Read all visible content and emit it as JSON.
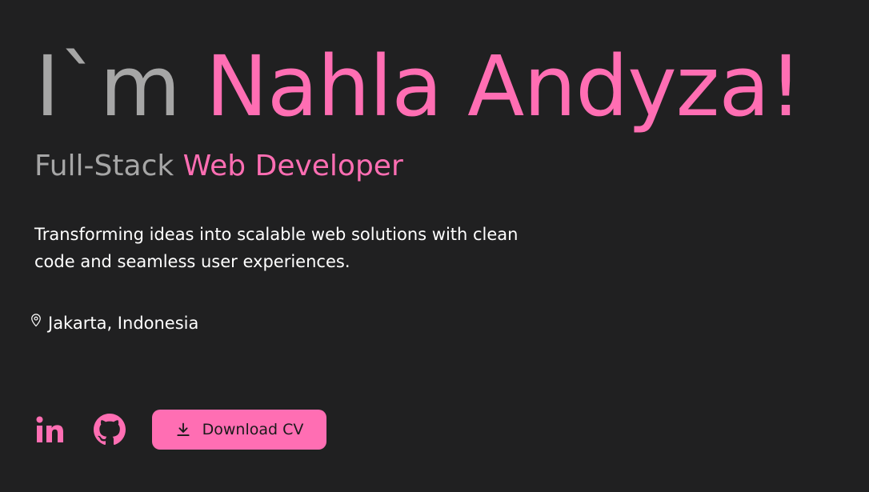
{
  "hero": {
    "greeting": "I`m",
    "name": "Nahla Andyza!",
    "role_prefix": "Full-Stack",
    "role_accent": "Web Developer",
    "tagline": "Transforming ideas into scalable web solutions with clean code and seamless user experiences.",
    "location": "Jakarta, Indonesia"
  },
  "social": [
    {
      "icon": "linkedin-icon"
    },
    {
      "icon": "github-icon"
    }
  ],
  "actions": {
    "download_cv_label": "Download CV"
  },
  "colors": {
    "background": "#202021",
    "accent": "#ff6eb3",
    "muted": "#a6a6a6",
    "text": "#ffffff"
  }
}
